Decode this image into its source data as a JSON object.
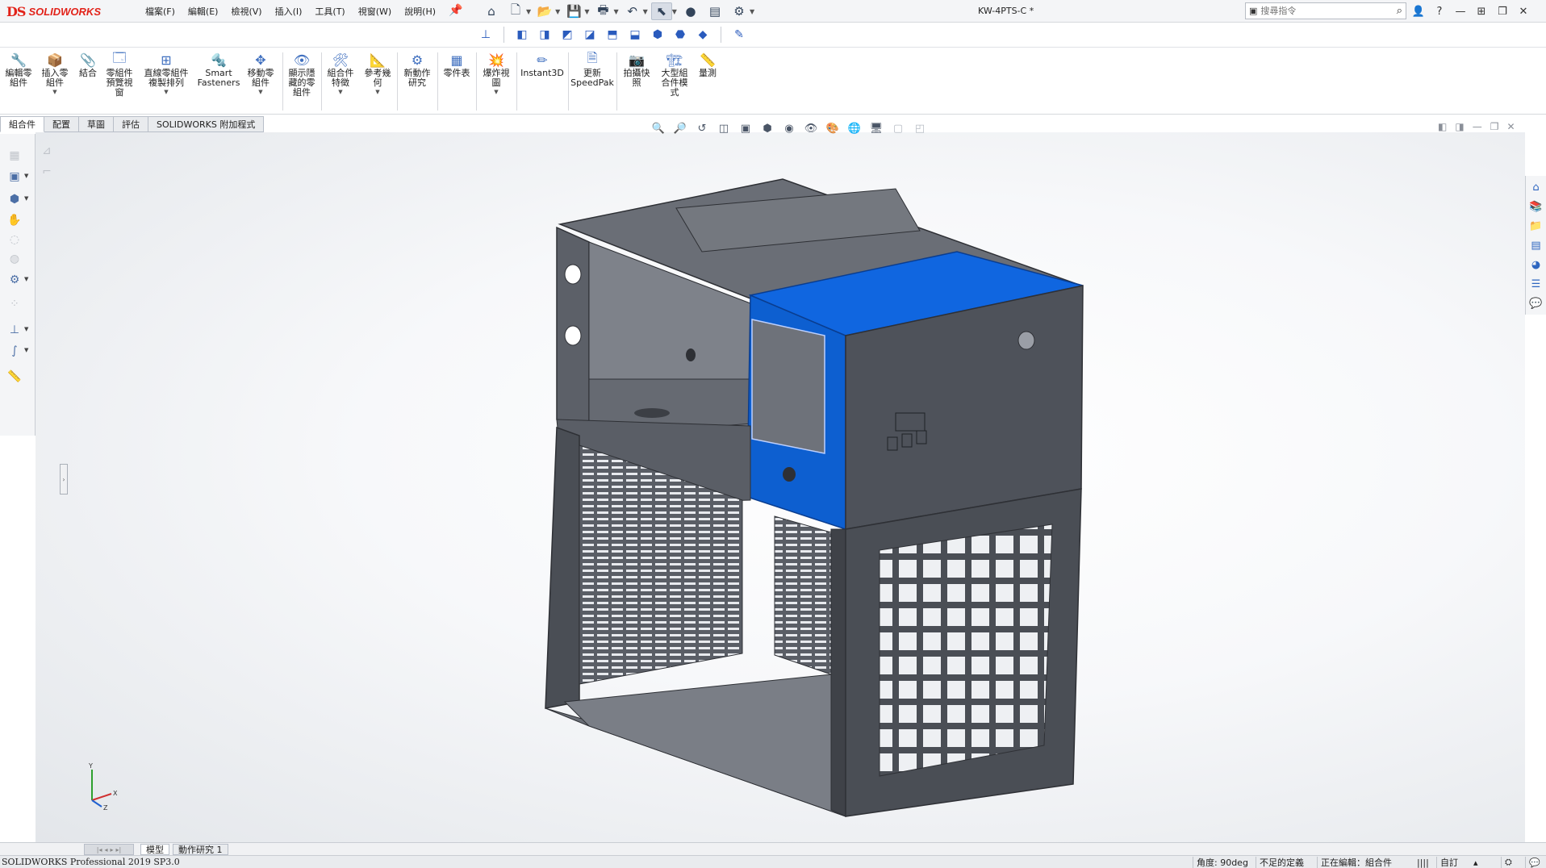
{
  "app": {
    "logo_ds": "DS",
    "logo_text": "SOLIDWORKS",
    "doc_title": "KW-4PTS-C *"
  },
  "menus": [
    "檔案(F)",
    "編輯(E)",
    "檢視(V)",
    "插入(I)",
    "工具(T)",
    "視窗(W)",
    "說明(H)"
  ],
  "search": {
    "placeholder": "搜尋指令"
  },
  "ribbon": {
    "edit_component": "編輯零\n組件",
    "insert_component": "插入零\n組件",
    "mate": "結合",
    "component_preview": "零組件\n預覽視\n窗",
    "linear_pattern": "直線零組件\n複製排列",
    "smart_fasteners": "Smart\nFasteners",
    "move_component": "移動零\n組件",
    "show_hidden": "顯示隱\n藏的零\n組件",
    "assembly_features": "組合件\n特徵",
    "reference_geometry": "參考幾\n何",
    "new_motion_study": "新動作\n研究",
    "bom": "零件表",
    "exploded_view": "爆炸視\n圖",
    "instant3d": "Instant3D",
    "update_speedpak": "更新\nSpeedPak",
    "take_snapshot": "拍攝快\n照",
    "large_assembly": "大型組\n合件模\n式",
    "measure": "量測"
  },
  "cm_tabs": [
    "組合件",
    "配置",
    "草圖",
    "評估",
    "SOLIDWORKS 附加程式"
  ],
  "bottom_tabs": [
    "模型",
    "動作研究 1"
  ],
  "status": {
    "product": "SOLIDWORKS Professional 2019 SP3.0",
    "angle": "角度: 90deg",
    "definition": "不足的定義",
    "editing": "正在編輯：組合件",
    "custom": "自訂"
  },
  "triad": {
    "x": "X",
    "y": "Y",
    "z": "Z"
  },
  "colors": {
    "accent": "#1f57b3",
    "highlight_face": "#0d5fd0",
    "sheet_metal": "#4a4e55"
  }
}
